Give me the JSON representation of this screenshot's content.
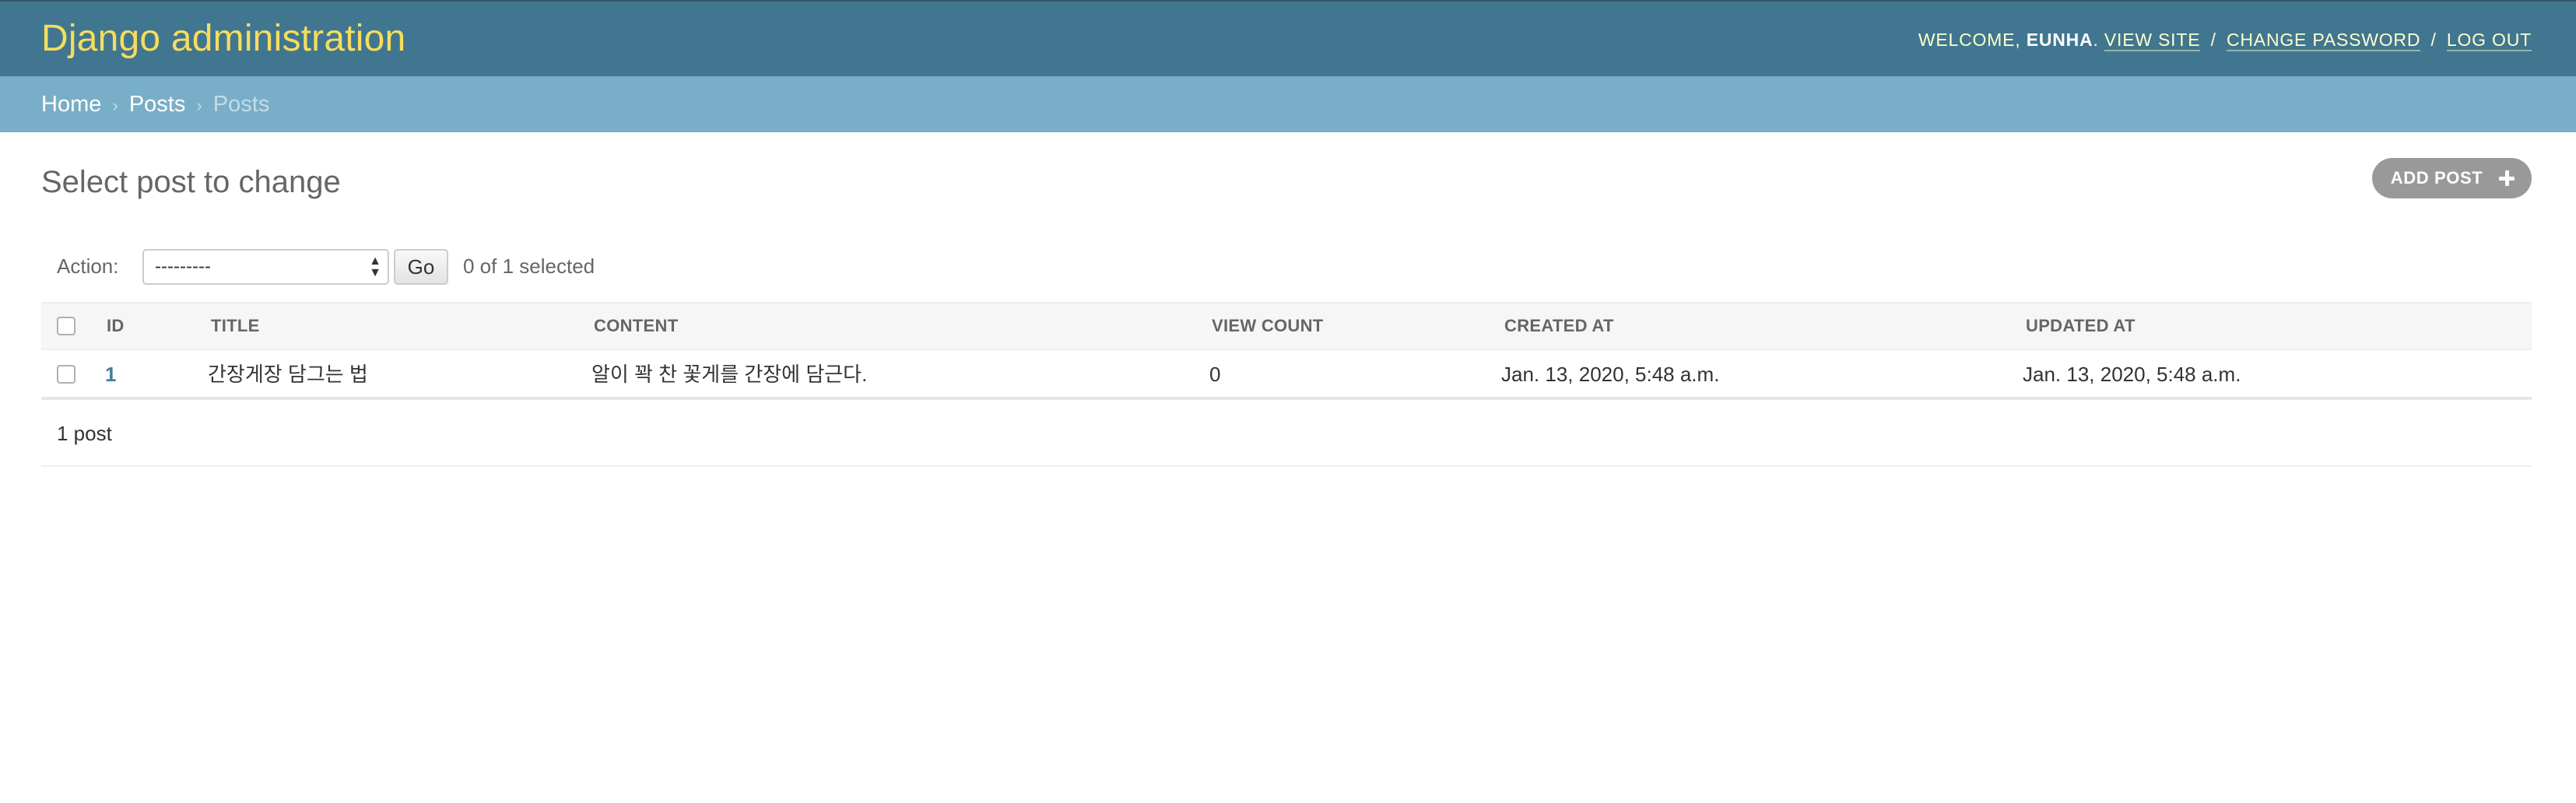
{
  "header": {
    "site_name": "Django administration",
    "welcome_prefix": "WELCOME,",
    "username": "EUNHA",
    "welcome_suffix": ".",
    "view_site": "VIEW SITE",
    "change_password": "CHANGE PASSWORD",
    "log_out": "LOG OUT",
    "separator": "/"
  },
  "breadcrumbs": {
    "items": [
      "Home",
      "Posts",
      "Posts"
    ],
    "separator": "›"
  },
  "page": {
    "title": "Select post to change",
    "add_button_label": "ADD POST"
  },
  "actions": {
    "label": "Action:",
    "selected_option": "---------",
    "go_label": "Go",
    "selection_count": "0 of 1 selected"
  },
  "table": {
    "columns": [
      "ID",
      "TITLE",
      "CONTENT",
      "VIEW COUNT",
      "CREATED AT",
      "UPDATED AT"
    ],
    "rows": [
      {
        "id": "1",
        "title": "간장게장 담그는 법",
        "content": "알이 꽉 찬 꽃게를 간장에 담근다.",
        "view_count": "0",
        "created_at": "Jan. 13, 2020, 5:48 a.m.",
        "updated_at": "Jan. 13, 2020, 5:48 a.m."
      }
    ]
  },
  "paginator": {
    "text": "1 post"
  },
  "colors": {
    "header_bg": "#417690",
    "breadcrumb_bg": "#79aec8",
    "branding": "#f5dd5d",
    "link": "#447e9b",
    "add_button_bg": "#999999"
  }
}
